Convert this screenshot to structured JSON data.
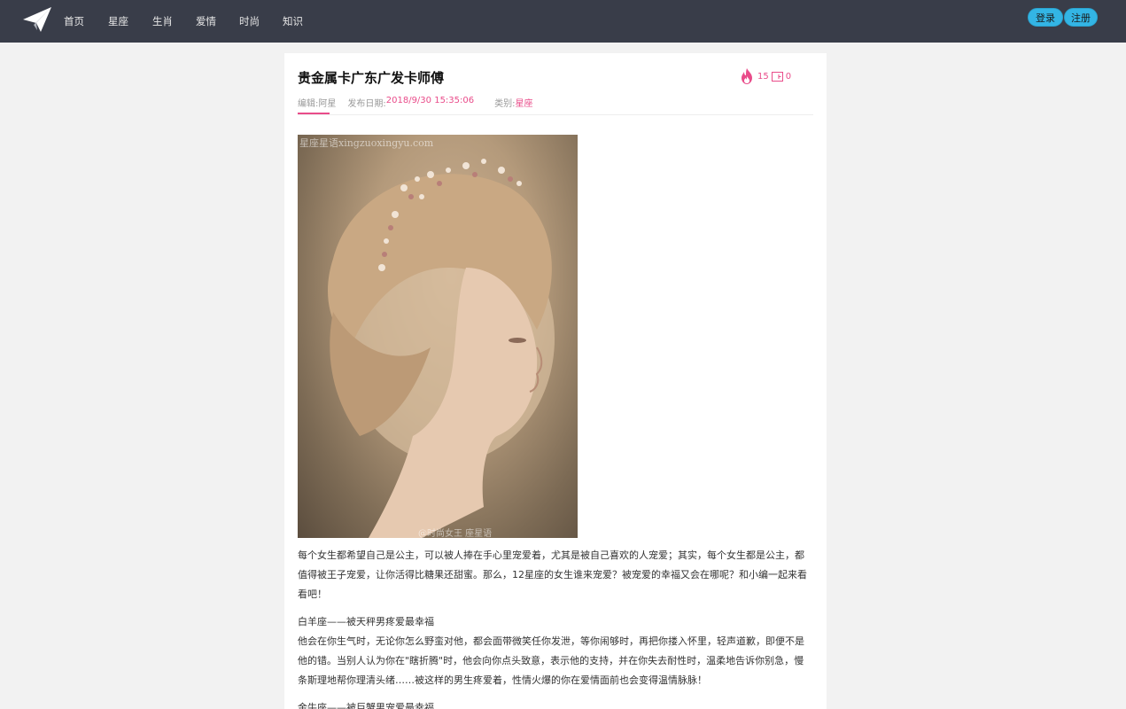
{
  "nav": {
    "items": [
      "首页",
      "星座",
      "生肖",
      "爱情",
      "时尚",
      "知识"
    ],
    "login_label": "登录",
    "register_label": "注册"
  },
  "article": {
    "title": "贵金属卡广东广发卡师傅",
    "views": "15",
    "comments": "0",
    "meta": {
      "editor_label": "编辑:",
      "editor": "阿星",
      "date_label": "发布日期:",
      "date": "2018/9/30 15:35:06",
      "category_label": "类别:",
      "category": "星座"
    },
    "image_watermark_top": "星座星语xingzuoxingyu.com",
    "image_watermark_bottom": "@时尚女王 座星语xingzuoxingyu.com",
    "paragraphs": [
      "每个女生都希望自己是公主，可以被人捧在手心里宠爱着，尤其是被自己喜欢的人宠爱；其实，每个女生都是公主，都值得被王子宠爱，让你活得比糖果还甜蜜。那么，12星座的女生谁来宠爱？被宠爱的幸福又会在哪呢？和小编一起来看看吧！",
      "白羊座——被天秤男疼爱最幸福",
      "他会在你生气时，无论你怎么野蛮对他，都会面带微笑任你发泄，等你闹够时，再把你搂入怀里，轻声道歉，即便不是他的错。当别人认为你在\"瞎折腾\"时，他会向你点头致意，表示他的支持，并在你失去耐性时，温柔地告诉你别急，慢条斯理地帮你理清头绪……被这样的男生疼爱着，性情火爆的你在爱情面前也会变得温情脉脉！",
      "金牛座——被巨蟹男宠爱最幸福"
    ]
  },
  "colors": {
    "topbar": "#393d49",
    "accent": "#e94c8a",
    "button": "#33b5e5"
  }
}
